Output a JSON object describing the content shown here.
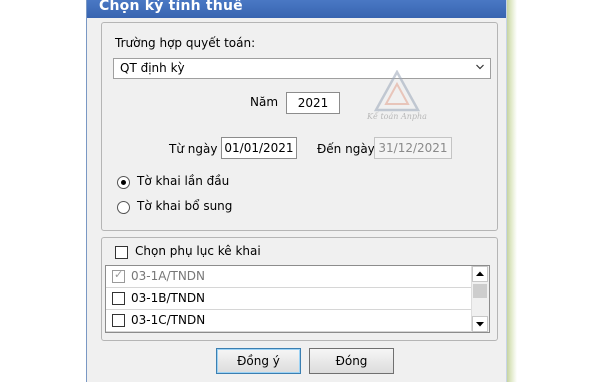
{
  "dialog": {
    "title": "Chọn kỳ tính thuế",
    "case_label": "Trường hợp quyết toán:",
    "case_value": "QT định kỳ",
    "year_label": "Năm",
    "year_value": "2021",
    "from_label": "Từ ngày",
    "from_value": "01/01/2021",
    "to_label": "Đến ngày",
    "to_value": "31/12/2021",
    "radios": [
      {
        "label": "Tờ khai lần đầu",
        "selected": true
      },
      {
        "label": "Tờ khai bổ sung",
        "selected": false
      }
    ],
    "appendix": {
      "checkbox_label": "Chọn phụ lục kê khai",
      "checked": false,
      "items": [
        {
          "label": "03-1A/TNDN",
          "checked": true,
          "disabled": true
        },
        {
          "label": "03-1B/TNDN",
          "checked": false,
          "disabled": false
        },
        {
          "label": "03-1C/TNDN",
          "checked": false,
          "disabled": false
        }
      ]
    },
    "buttons": {
      "ok": "Đồng ý",
      "close": "Đóng"
    }
  },
  "watermark": {
    "text": "Kế toán Anpha"
  },
  "colors": {
    "titlebar": "#3c6ab6",
    "dialog_bg": "#f0f0f0",
    "default_button_border": "#3c7fb1"
  }
}
